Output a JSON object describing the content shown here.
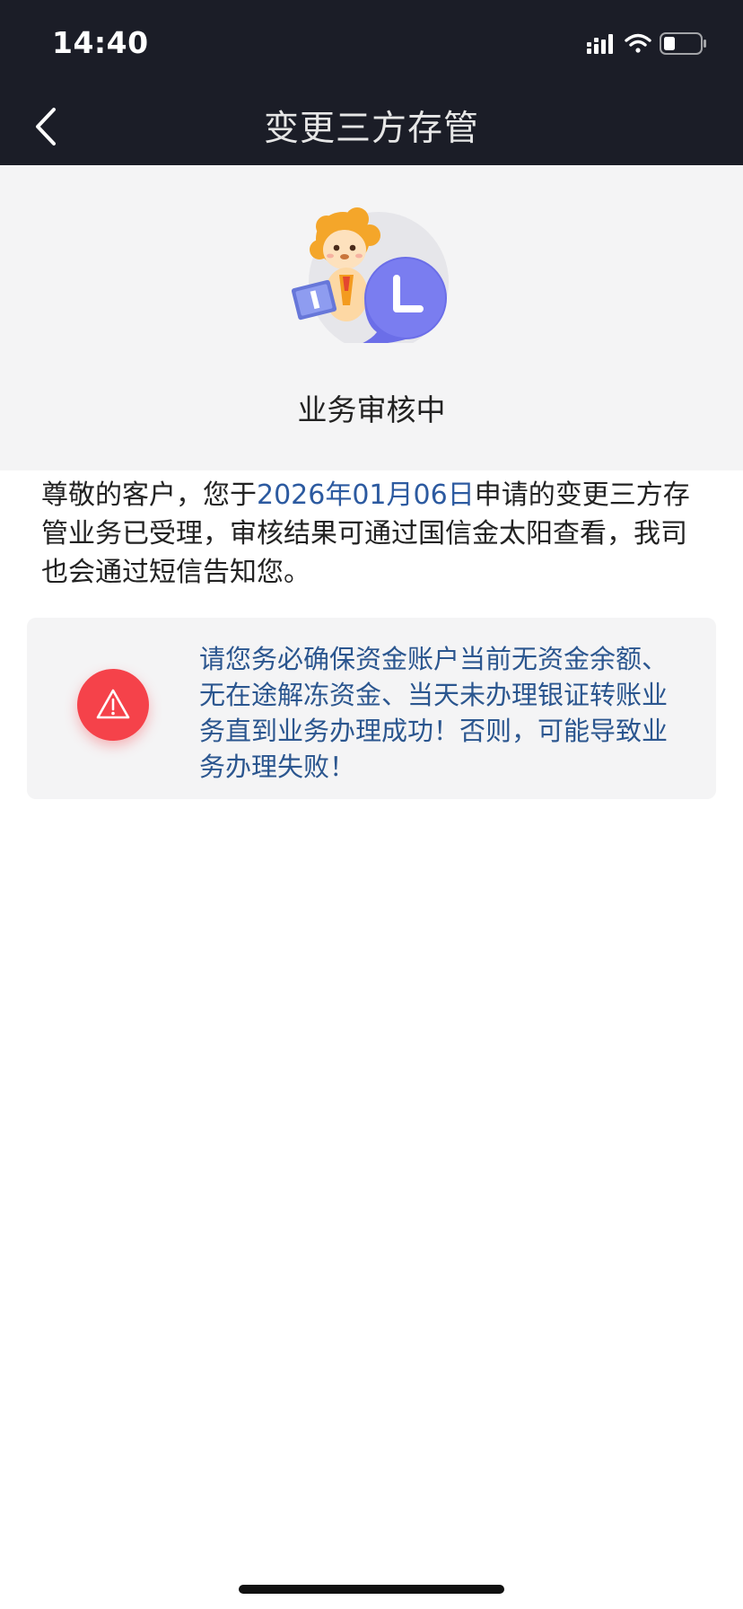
{
  "status_bar": {
    "time": "14:40"
  },
  "nav": {
    "title": "变更三方存管"
  },
  "hero": {
    "status": "业务审核中"
  },
  "message": {
    "prefix": "尊敬的客户，您于",
    "date": "2026年01月06日",
    "suffix": "申请的变更三方存管业务已受理，审核结果可通过国信金太阳查看，我司也会通过短信告知您。"
  },
  "warning": {
    "icon": "warning-triangle-icon",
    "text": "请您务必确保资金账户当前无资金余额、无在途解冻资金、当天未办理银证转账业务直到业务办理成功！否则，可能导致业务办理失败！"
  },
  "colors": {
    "header_bg": "#1b1d27",
    "date_accent": "#2c5aa0",
    "warning_red": "#f5424a",
    "warning_text": "#2b568f"
  }
}
